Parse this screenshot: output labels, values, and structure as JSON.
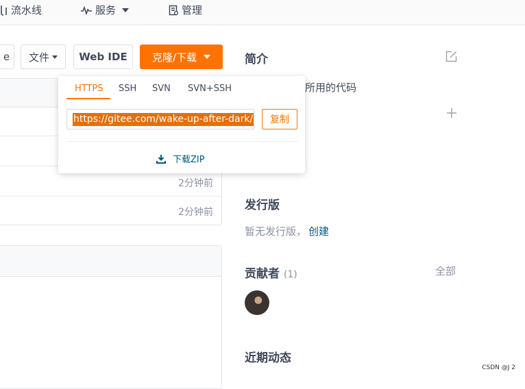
{
  "topnav": {
    "pipeline": "流水线",
    "services": "服务",
    "manage": "管理"
  },
  "toolbar": {
    "partial_button": "e",
    "file_button": "文件",
    "webide_button": "Web IDE",
    "clone_button": "克隆/下载"
  },
  "clone_popup": {
    "tabs": [
      "HTTPS",
      "SSH",
      "SVN",
      "SVN+SSH"
    ],
    "active_tab": "HTTPS",
    "url": "https://gitee.com/wake-up-after-dark/",
    "copy_label": "复制",
    "download_zip_label": "下载ZIP"
  },
  "file_list": {
    "rows": [
      {
        "time": ""
      },
      {
        "time": ""
      },
      {
        "time": "2分钟前"
      },
      {
        "time": "2分钟前"
      }
    ]
  },
  "sidebar": {
    "intro_title": "简介",
    "intro_text": "所用的代码",
    "releases_title": "发行版",
    "releases_none": "暂无发行版，",
    "releases_create": "创建",
    "contributors_title": "贡献者",
    "contributors_count": "(1)",
    "contributors_all": "全部",
    "activity_title": "近期动态"
  },
  "watermark": "CSDN @J 2",
  "colors": {
    "accent": "#fe7300",
    "link": "#005980",
    "muted": "#8c92a4",
    "text": "#40485b"
  }
}
